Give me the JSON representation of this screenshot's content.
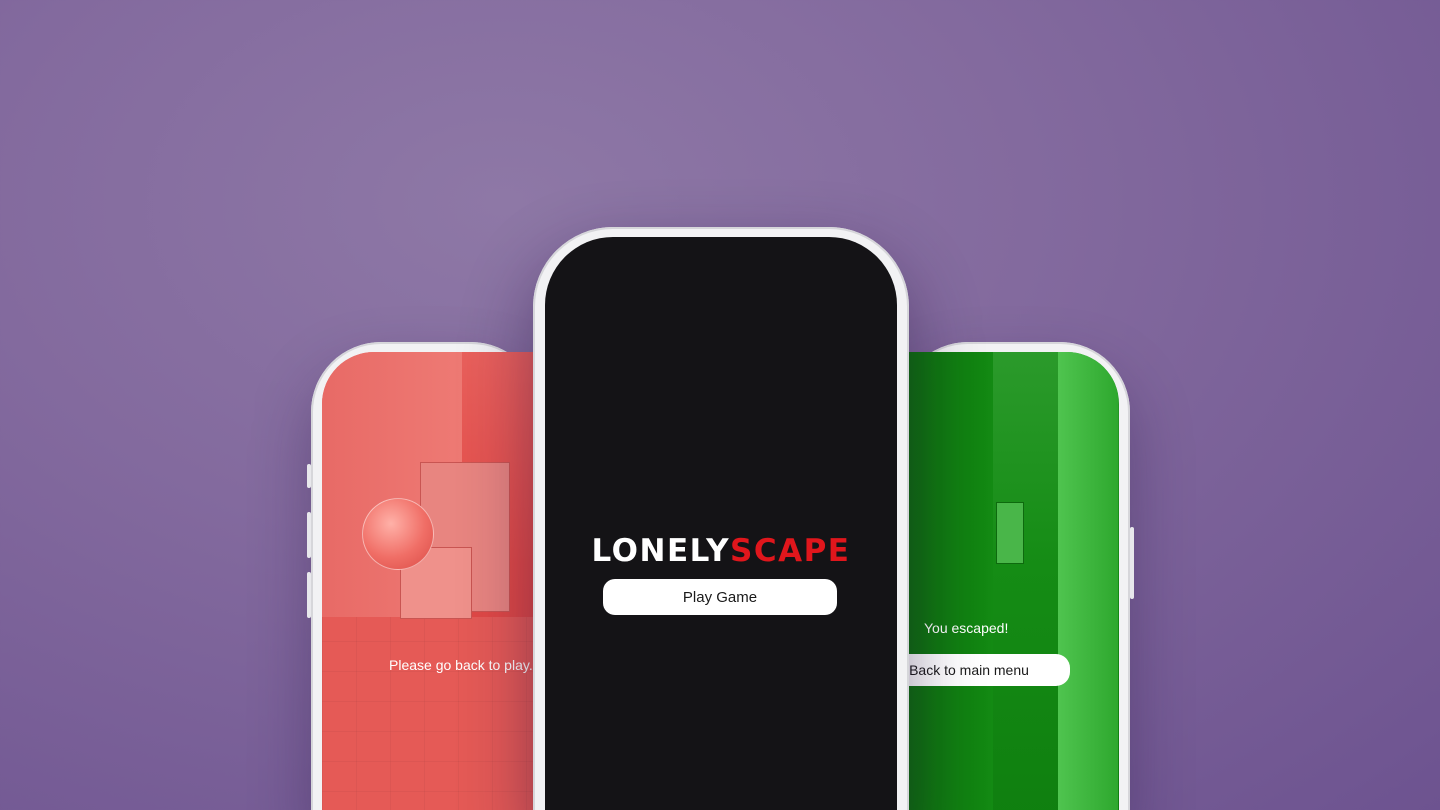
{
  "left_phone": {
    "message": "Please go back to play."
  },
  "center_phone": {
    "logo": {
      "part1": "LONELY",
      "part2": "SCAPE"
    },
    "play_button_label": "Play Game"
  },
  "right_phone": {
    "message": "You escaped!",
    "back_button_label": "Back to main menu"
  },
  "colors": {
    "background": "#836a9e",
    "center_screen": "#141316",
    "logo_accent": "#e0161c",
    "red_overlay": "#e24a47",
    "green_overlay": "#158c15"
  }
}
